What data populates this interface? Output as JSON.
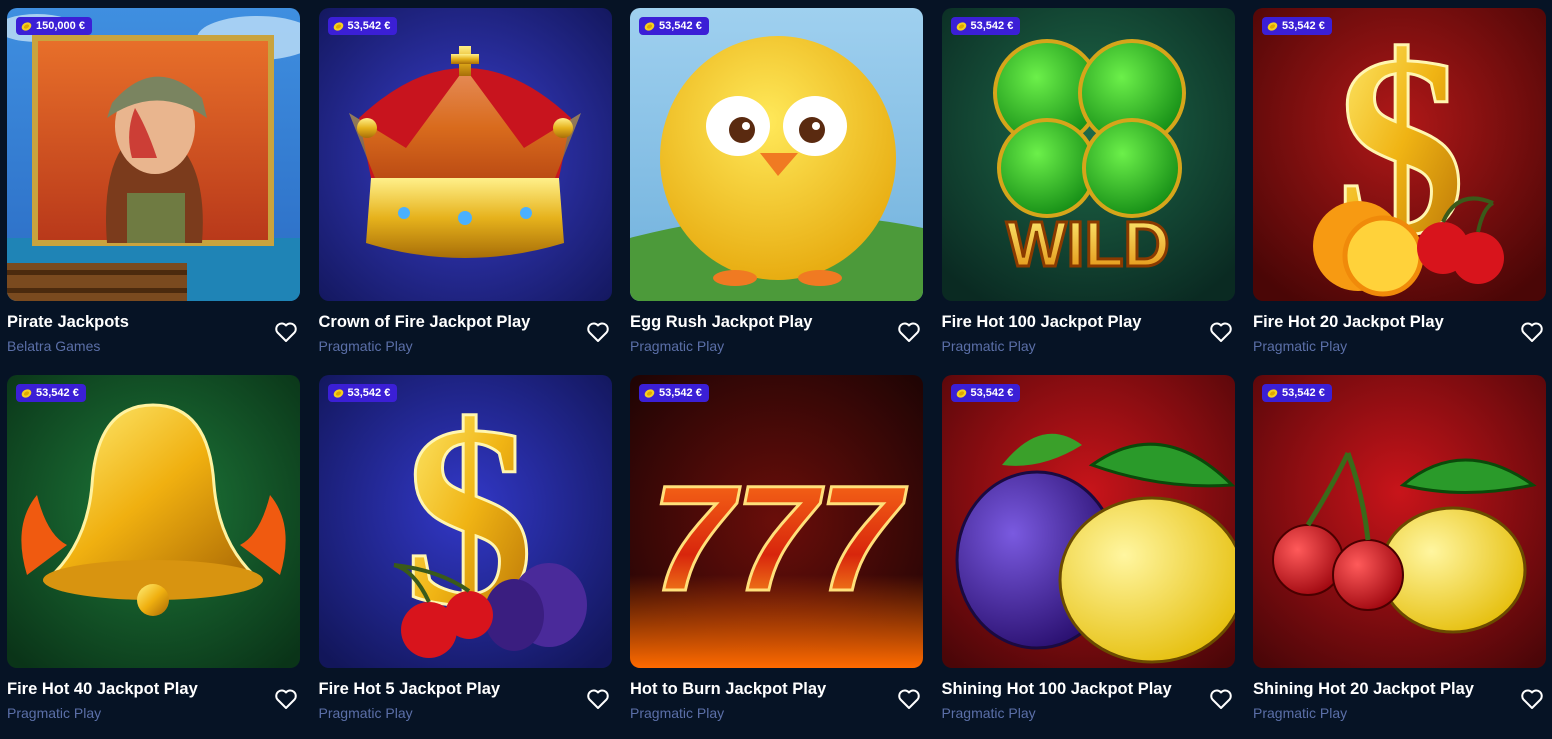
{
  "colors": {
    "page_background": "#061325",
    "jackpot_badge": "#3b1fd6",
    "title_text": "#ffffff",
    "provider_text": "#5b6fa8"
  },
  "games": [
    {
      "title": "Pirate Jackpots",
      "provider": "Belatra Games",
      "jackpot": "150,000 €",
      "art": "pirate-woman"
    },
    {
      "title": "Crown of Fire Jackpot Play",
      "provider": "Pragmatic Play",
      "jackpot": "53,542 €",
      "art": "golden-crown"
    },
    {
      "title": "Egg Rush Jackpot Play",
      "provider": "Pragmatic Play",
      "jackpot": "53,542 €",
      "art": "yellow-chick"
    },
    {
      "title": "Fire Hot 100 Jackpot Play",
      "provider": "Pragmatic Play",
      "jackpot": "53,542 €",
      "art": "clover-wild"
    },
    {
      "title": "Fire Hot 20 Jackpot Play",
      "provider": "Pragmatic Play",
      "jackpot": "53,542 €",
      "art": "dollar-orange-cherries"
    },
    {
      "title": "Fire Hot 40 Jackpot Play",
      "provider": "Pragmatic Play",
      "jackpot": "53,542 €",
      "art": "golden-bell"
    },
    {
      "title": "Fire Hot 5 Jackpot Play",
      "provider": "Pragmatic Play",
      "jackpot": "53,542 €",
      "art": "dollar-cherries-plum"
    },
    {
      "title": "Hot to Burn Jackpot Play",
      "provider": "Pragmatic Play",
      "jackpot": "53,542 €",
      "art": "flaming-777"
    },
    {
      "title": "Shining Hot 100 Jackpot Play",
      "provider": "Pragmatic Play",
      "jackpot": "53,542 €",
      "art": "plum-lemon"
    },
    {
      "title": "Shining Hot 20 Jackpot Play",
      "provider": "Pragmatic Play",
      "jackpot": "53,542 €",
      "art": "cherries-lemon"
    }
  ],
  "art_labels": {
    "wild": "WILD",
    "sevens": "777"
  },
  "icons": {
    "jackpot": "coin-icon",
    "favorite": "heart-outline-icon"
  }
}
